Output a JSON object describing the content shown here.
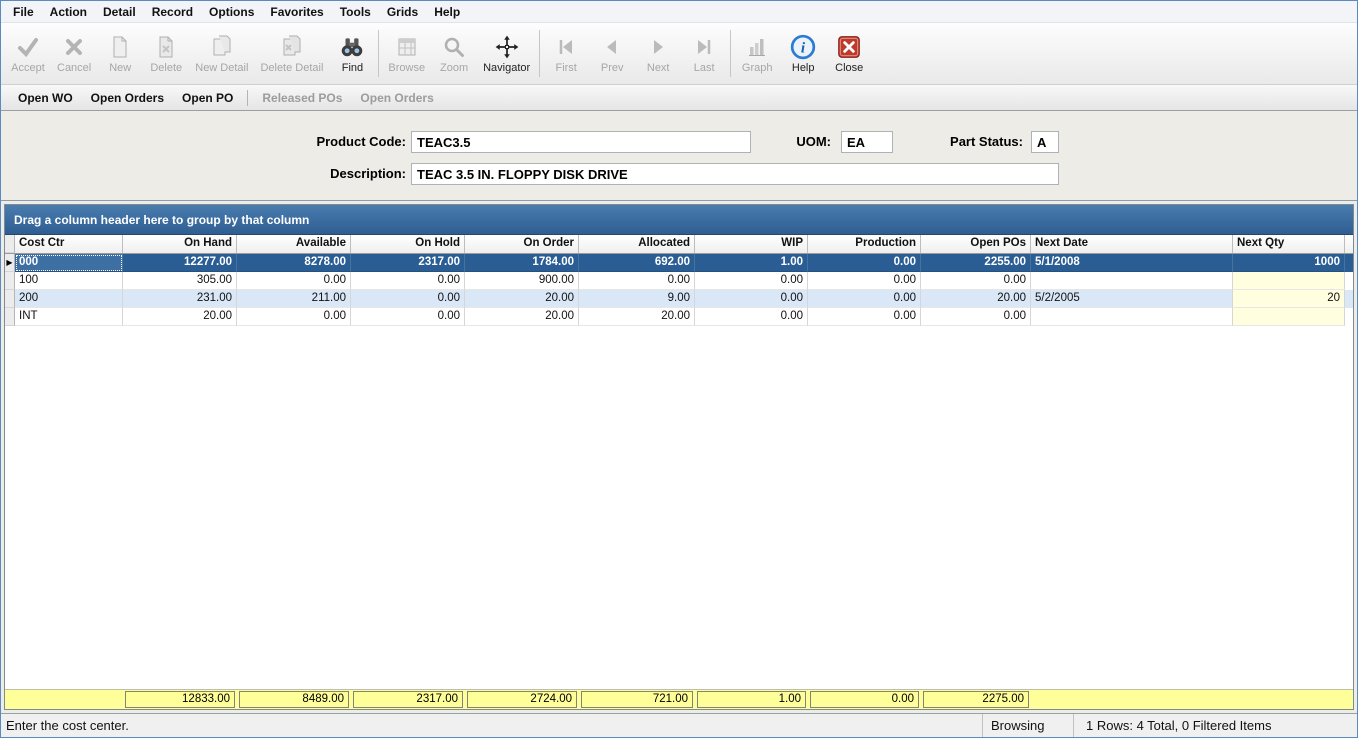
{
  "menu": {
    "items": [
      "File",
      "Action",
      "Detail",
      "Record",
      "Options",
      "Favorites",
      "Tools",
      "Grids",
      "Help"
    ]
  },
  "toolbar": {
    "buttons": [
      {
        "label": "Accept",
        "icon": "accept",
        "enabled": false
      },
      {
        "label": "Cancel",
        "icon": "cancel",
        "enabled": false
      },
      {
        "label": "New",
        "icon": "new-doc",
        "enabled": false
      },
      {
        "label": "Delete",
        "icon": "delete-doc",
        "enabled": false
      },
      {
        "label": "New Detail",
        "icon": "new-detail",
        "enabled": false
      },
      {
        "label": "Delete Detail",
        "icon": "delete-detail",
        "enabled": false
      },
      {
        "label": "Find",
        "icon": "find-binoculars",
        "enabled": true
      },
      {
        "sep": true
      },
      {
        "label": "Browse",
        "icon": "browse",
        "enabled": false
      },
      {
        "label": "Zoom",
        "icon": "zoom-magnifier",
        "enabled": false
      },
      {
        "label": "Navigator",
        "icon": "navigator-crosshair",
        "enabled": true
      },
      {
        "sep": true
      },
      {
        "label": "First",
        "icon": "nav-first",
        "enabled": false
      },
      {
        "label": "Prev",
        "icon": "nav-prev",
        "enabled": false
      },
      {
        "label": "Next",
        "icon": "nav-next",
        "enabled": false
      },
      {
        "label": "Last",
        "icon": "nav-last",
        "enabled": false
      },
      {
        "sep": true
      },
      {
        "label": "Graph",
        "icon": "graph",
        "enabled": false
      },
      {
        "label": "Help",
        "icon": "help",
        "enabled": true
      },
      {
        "label": "Close",
        "icon": "close",
        "enabled": true
      }
    ]
  },
  "quickbar": {
    "buttons": [
      {
        "label": "Open WO",
        "enabled": true
      },
      {
        "label": "Open Orders",
        "enabled": true
      },
      {
        "label": "Open PO",
        "enabled": true
      },
      {
        "sep": true
      },
      {
        "label": "Released POs",
        "enabled": false
      },
      {
        "label": "Open Orders",
        "enabled": false
      }
    ]
  },
  "form": {
    "product_code_label": "Product Code:",
    "product_code": "TEAC3.5",
    "uom_label": "UOM:",
    "uom": "EA",
    "part_status_label": "Part Status:",
    "part_status": "A",
    "description_label": "Description:",
    "description": "TEAC 3.5 IN. FLOPPY DISK DRIVE"
  },
  "grid": {
    "group_hint": "Drag a column header here to group by that column",
    "columns": [
      "Cost Ctr",
      "On Hand",
      "Available",
      "On Hold",
      "On Order",
      "Allocated",
      "WIP",
      "Production",
      "Open POs",
      "Next Date",
      "Next Qty"
    ],
    "rows": [
      {
        "selected": true,
        "cells": [
          "000",
          "12277.00",
          "8278.00",
          "2317.00",
          "1784.00",
          "692.00",
          "1.00",
          "0.00",
          "2255.00",
          "5/1/2008",
          "1000"
        ]
      },
      {
        "selected": false,
        "cells": [
          "100",
          "305.00",
          "0.00",
          "0.00",
          "900.00",
          "0.00",
          "0.00",
          "0.00",
          "0.00",
          "",
          ""
        ]
      },
      {
        "selected": false,
        "cells": [
          "200",
          "231.00",
          "211.00",
          "0.00",
          "20.00",
          "9.00",
          "0.00",
          "0.00",
          "20.00",
          "5/2/2005",
          "20"
        ]
      },
      {
        "selected": false,
        "cells": [
          "INT",
          "20.00",
          "0.00",
          "0.00",
          "20.00",
          "20.00",
          "0.00",
          "0.00",
          "0.00",
          "",
          ""
        ]
      }
    ],
    "totals": [
      "",
      "12833.00",
      "8489.00",
      "2317.00",
      "2724.00",
      "721.00",
      "1.00",
      "0.00",
      "2275.00",
      "",
      ""
    ]
  },
  "statusbar": {
    "message": "Enter the cost center.",
    "mode": "Browsing",
    "rows_info": "1 Rows: 4 Total, 0 Filtered Items"
  },
  "colors": {
    "group_bar_blue": "#36689c",
    "selected_row_blue": "#2a5d93",
    "alt_row_blue": "#d9e7f7",
    "qty_cell_cream": "#ffffe0",
    "totals_yellow": "#ffff99",
    "help_blue": "#2b7bd4",
    "close_red": "#c0392b",
    "accept_green": "#3f9b3f"
  }
}
